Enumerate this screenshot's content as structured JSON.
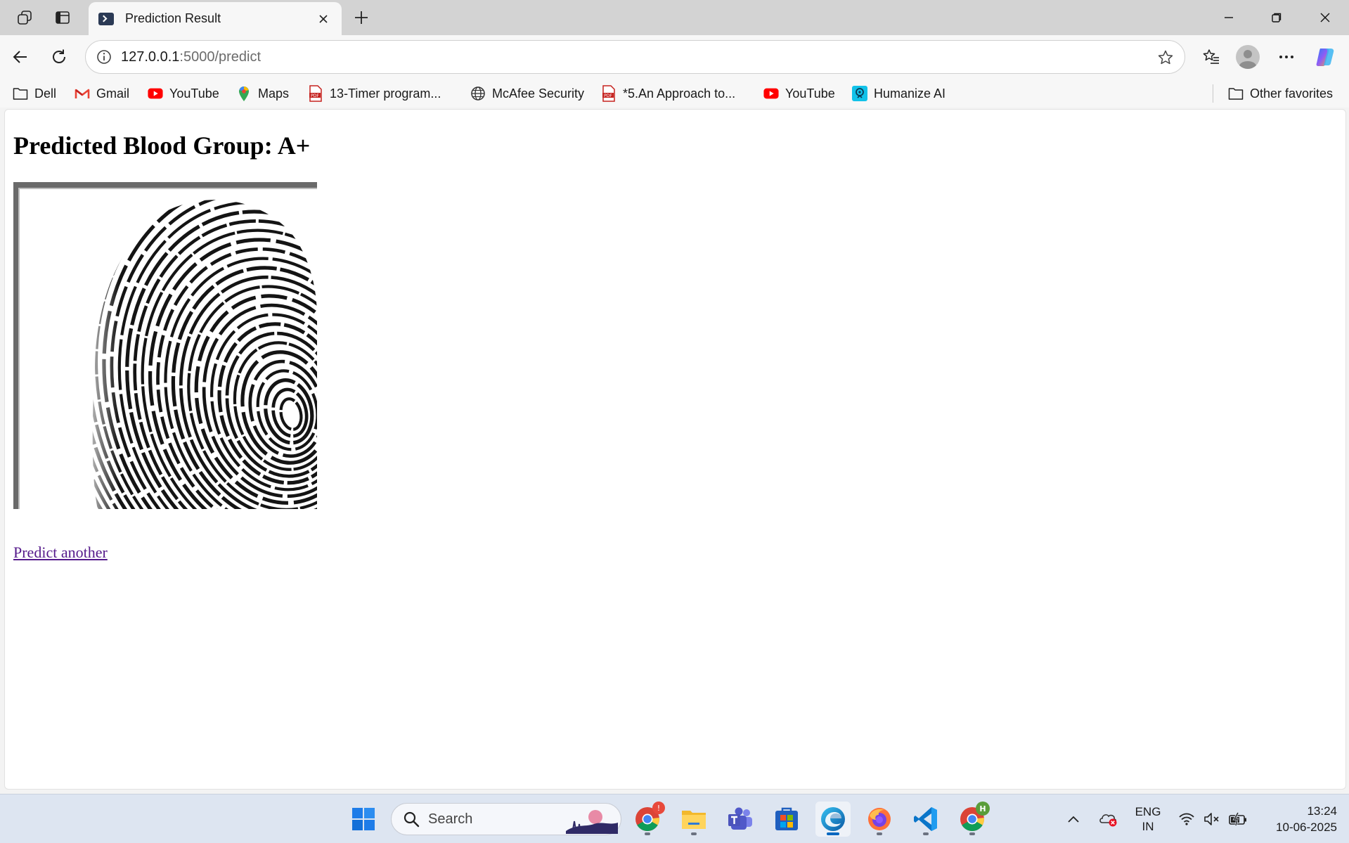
{
  "browser": {
    "tab": {
      "title": "Prediction Result",
      "favicon": "terminal-icon"
    },
    "address": {
      "host": "127.0.0.1",
      "path": ":5000/predict"
    },
    "favorites": [
      {
        "label": "Dell",
        "icon": "folder-icon"
      },
      {
        "label": "Gmail",
        "icon": "gmail-icon"
      },
      {
        "label": "YouTube",
        "icon": "youtube-icon"
      },
      {
        "label": "Maps",
        "icon": "maps-icon"
      },
      {
        "label": "13-Timer program...",
        "icon": "pdf-icon"
      },
      {
        "label": "McAfee Security",
        "icon": "globe-icon"
      },
      {
        "label": "*5.An Approach to...",
        "icon": "pdf-icon"
      },
      {
        "label": "YouTube",
        "icon": "youtube-icon"
      },
      {
        "label": "Humanize AI",
        "icon": "humanize-icon"
      }
    ],
    "other_favorites": "Other favorites"
  },
  "page": {
    "heading": "Predicted Blood Group: A+",
    "fingerprint_alt": "fingerprint-image",
    "link": "Predict another"
  },
  "taskbar": {
    "search_placeholder": "Search",
    "apps": [
      "start-icon",
      "chrome-icon",
      "file-explorer-icon",
      "teams-icon",
      "store-icon",
      "edge-icon",
      "firefox-icon",
      "vscode-icon",
      "chrome-profile-icon"
    ],
    "chrome_badge": "!",
    "chrome_profile_badge": "H",
    "language": {
      "line1": "ENG",
      "line2": "IN"
    },
    "time": "13:24",
    "date": "10-06-2025"
  },
  "colors": {
    "tabstrip": "#d3d3d3",
    "toolbar": "#f7f7f7",
    "link_visited": "#551a8b",
    "taskbar": "#dde5f1",
    "accent": "#0067c0"
  }
}
